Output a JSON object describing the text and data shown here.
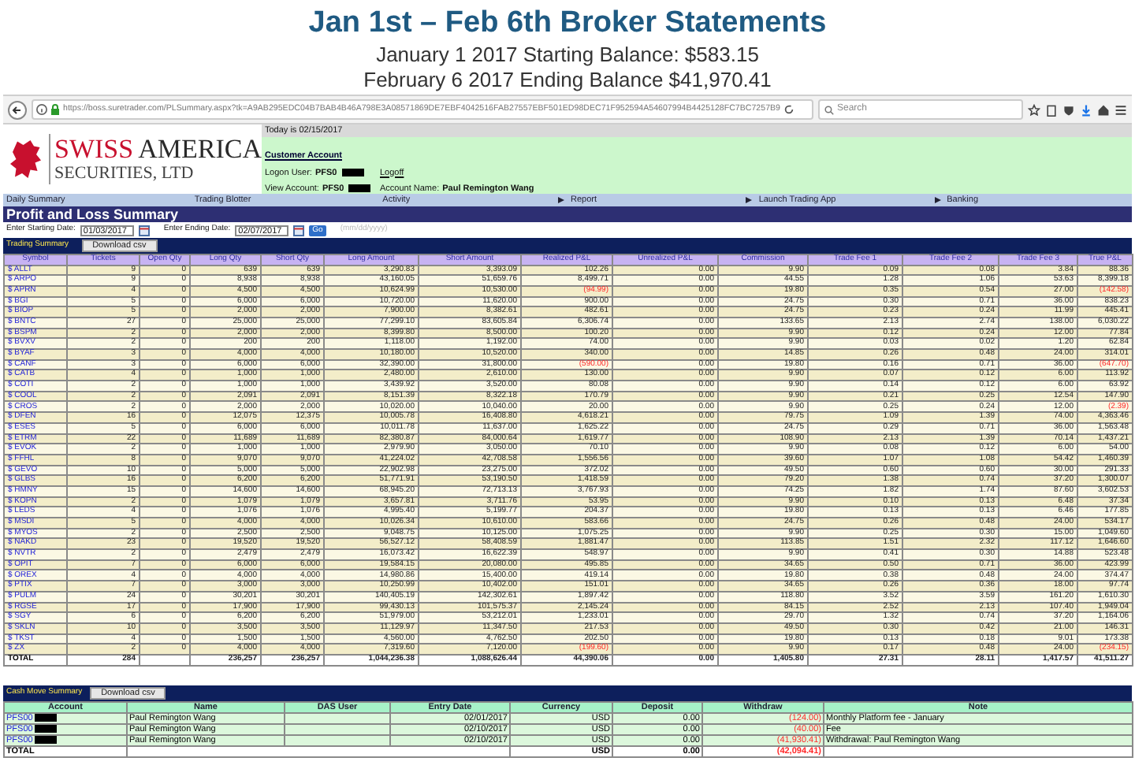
{
  "heading": {
    "title": "Jan 1st – Feb 6th Broker Statements",
    "lines": [
      "January 1 2017 Starting Balance: $583.15",
      "February 6 2017 Ending Balance $41,970.41"
    ]
  },
  "browser": {
    "url": "https://boss.suretrader.com/PLSummary.aspx?tk=A9AB295EDC04B7BAB4B46A798E3A08571869DE7EBF4042516FAB27557EBF501ED98DEC71F952594A54607994B4425128FC7BC7257B9",
    "search": {
      "placeholder": "Search"
    }
  },
  "site": {
    "logo_title_a": "SWISS",
    "logo_title_b": "AMERICA",
    "logo_subtitle": "SECURITIES, LTD",
    "today": "Today is 02/15/2017",
    "customer_account": "Customer Account",
    "logon_label": "Logon User:",
    "logon_value": "PFS0",
    "logoff": "Logoff",
    "view_label": "View Account:",
    "view_value": "PFS0",
    "account_name_label": "Account Name:",
    "account_name": "Paul Remington Wang"
  },
  "nav": [
    {
      "label": "Daily Summary",
      "has_submenu": false
    },
    {
      "label": "Trading Blotter",
      "has_submenu": false
    },
    {
      "label": "Activity",
      "has_submenu": true
    },
    {
      "label": "Report",
      "has_submenu": true
    },
    {
      "label": "Launch Trading App",
      "has_submenu": true
    },
    {
      "label": "Banking",
      "has_submenu": false
    }
  ],
  "page_title": "Profit and Loss Summary",
  "dates": {
    "start_label": "Enter Starting Date:",
    "start_value": "01/03/2017",
    "end_label": "Enter Ending Date:",
    "end_value": "02/07/2017",
    "go": "Go",
    "format_hint": "(mm/dd/yyyy)"
  },
  "trading": {
    "title": "Trading Summary",
    "download": "Download csv",
    "columns": [
      "Symbol",
      "Tickets",
      "Open Qty",
      "Long Qty",
      "Short Qty",
      "Long Amount",
      "Short Amount",
      "Realized P&L",
      "Unrealized P&L",
      "Commission",
      "Trade Fee 1",
      "Trade Fee 2",
      "Trade Fee 3",
      "True P&L"
    ],
    "rows": [
      {
        "cells": [
          "$ ALLT",
          "9",
          "0",
          "639",
          "639",
          "3,290.83",
          "3,393.09",
          "102.26",
          "0.00",
          "9.90",
          "0.09",
          "0.08",
          "3.84",
          "88.36"
        ]
      },
      {
        "cells": [
          "$ ARPO",
          "9",
          "0",
          "8,938",
          "8,938",
          "43,160.05",
          "51,659.76",
          "8,499.71",
          "0.00",
          "44.55",
          "1.28",
          "1.06",
          "53.63",
          "8,399.18"
        ]
      },
      {
        "cells": [
          "$ APRN",
          "4",
          "0",
          "4,500",
          "4,500",
          "10,624.99",
          "10,530.00",
          {
            "text": "(94.99)",
            "negative": true
          },
          "0.00",
          "19.80",
          "0.35",
          "0.54",
          "27.00",
          {
            "text": "(142.58)",
            "negative": true
          }
        ]
      },
      {
        "cells": [
          "$ BGI",
          "5",
          "0",
          "6,000",
          "6,000",
          "10,720.00",
          "11,620.00",
          "900.00",
          "0.00",
          "24.75",
          "0.30",
          "0.71",
          "36.00",
          "838.23"
        ]
      },
      {
        "cells": [
          "$ BIOP",
          "5",
          "0",
          "2,000",
          "2,000",
          "7,900.00",
          "8,382.61",
          "482.61",
          "0.00",
          "24.75",
          "0.23",
          "0.24",
          "11.99",
          "445.41"
        ]
      },
      {
        "cells": [
          "$ BNTC",
          "27",
          "0",
          "25,000",
          "25,000",
          "77,299.10",
          "83,605.84",
          "6,306.74",
          "0.00",
          "133.65",
          "2.13",
          "2.74",
          "138.00",
          "6,030.22"
        ]
      },
      {
        "cells": [
          "$ BSPM",
          "2",
          "0",
          "2,000",
          "2,000",
          "8,399.80",
          "8,500.00",
          "100.20",
          "0.00",
          "9.90",
          "0.12",
          "0.24",
          "12.00",
          "77.84"
        ]
      },
      {
        "cells": [
          "$ BVXV",
          "2",
          "0",
          "200",
          "200",
          "1,118.00",
          "1,192.00",
          "74.00",
          "0.00",
          "9.90",
          "0.03",
          "0.02",
          "1.20",
          "62.84"
        ]
      },
      {
        "cells": [
          "$ BYAF",
          "3",
          "0",
          "4,000",
          "4,000",
          "10,180.00",
          "10,520.00",
          "340.00",
          "0.00",
          "14.85",
          "0.26",
          "0.48",
          "24.00",
          "314.01"
        ]
      },
      {
        "cells": [
          "$ CANF",
          "3",
          "0",
          "6,000",
          "6,000",
          "32,390.00",
          "31,800.00",
          {
            "text": "(590.00)",
            "negative": true
          },
          "0.00",
          "19.80",
          "0.16",
          "0.71",
          "36.00",
          {
            "text": "(647.70)",
            "negative": true
          }
        ]
      },
      {
        "cells": [
          "$ CATB",
          "4",
          "0",
          "1,000",
          "1,000",
          "2,480.00",
          "2,610.00",
          "130.00",
          "0.00",
          "9.90",
          "0.07",
          "0.12",
          "6.00",
          "113.92"
        ]
      },
      {
        "cells": [
          "$ COTI",
          "2",
          "0",
          "1,000",
          "1,000",
          "3,439.92",
          "3,520.00",
          "80.08",
          "0.00",
          "9.90",
          "0.14",
          "0.12",
          "6.00",
          "63.92"
        ]
      },
      {
        "cells": [
          "$ COOL",
          "2",
          "0",
          "2,091",
          "2,091",
          "8,151.39",
          "8,322.18",
          "170.79",
          "0.00",
          "9.90",
          "0.21",
          "0.25",
          "12.54",
          "147.90"
        ]
      },
      {
        "cells": [
          "$ CROS",
          "2",
          "0",
          "2,000",
          "2,000",
          "10,020.00",
          "10,040.00",
          "20.00",
          "0.00",
          "9.90",
          "0.25",
          "0.24",
          "12.00",
          {
            "text": "(2.39)",
            "negative": true
          }
        ]
      },
      {
        "cells": [
          "$ DFEN",
          "16",
          "0",
          "12,075",
          "12,375",
          "10,005.78",
          "16,408.80",
          "4,618.21",
          "0.00",
          "79.75",
          "1.09",
          "1.39",
          "74.00",
          "4,363.46"
        ]
      },
      {
        "cells": [
          "$ ESES",
          "5",
          "0",
          "6,000",
          "6,000",
          "10,011.78",
          "11,637.00",
          "1,625.22",
          "0.00",
          "24.75",
          "0.29",
          "0.71",
          "36.00",
          "1,563.48"
        ]
      },
      {
        "cells": [
          "$ ETRM",
          "22",
          "0",
          "11,689",
          "11,689",
          "82,380.87",
          "84,000.64",
          "1,619.77",
          "0.00",
          "108.90",
          "2.13",
          "1.39",
          "70.14",
          "1,437.21"
        ]
      },
      {
        "cells": [
          "$ EVOK",
          "2",
          "0",
          "1,000",
          "1,000",
          "2,979.90",
          "3,050.00",
          "70.10",
          "0.00",
          "9.90",
          "0.08",
          "0.12",
          "6.00",
          "54.00"
        ]
      },
      {
        "cells": [
          "$ FFHL",
          "8",
          "0",
          "9,070",
          "9,070",
          "41,224.02",
          "42,708.58",
          "1,556.56",
          "0.00",
          "39.60",
          "1.07",
          "1.08",
          "54.42",
          "1,460.39"
        ]
      },
      {
        "cells": [
          "$ GEVO",
          "10",
          "0",
          "5,000",
          "5,000",
          "22,902.98",
          "23,275.00",
          "372.02",
          "0.00",
          "49.50",
          "0.60",
          "0.60",
          "30.00",
          "291.33"
        ]
      },
      {
        "cells": [
          "$ GLBS",
          "16",
          "0",
          "6,200",
          "6,200",
          "51,771.91",
          "53,190.50",
          "1,418.59",
          "0.00",
          "79.20",
          "1.38",
          "0.74",
          "37.20",
          "1,300.07"
        ]
      },
      {
        "cells": [
          "$ HMNY",
          "15",
          "0",
          "14,600",
          "14,600",
          "68,945.20",
          "72,713.13",
          "3,767.93",
          "0.00",
          "74.25",
          "1.82",
          "1.74",
          "87.60",
          "3,602.53"
        ]
      },
      {
        "cells": [
          "$ KOPN",
          "2",
          "0",
          "1,079",
          "1,079",
          "3,657.81",
          "3,711.76",
          "53.95",
          "0.00",
          "9.90",
          "0.10",
          "0.13",
          "6.48",
          "37.34"
        ]
      },
      {
        "cells": [
          "$ LEDS",
          "4",
          "0",
          "1,076",
          "1,076",
          "4,995.40",
          "5,199.77",
          "204.37",
          "0.00",
          "19.80",
          "0.13",
          "0.13",
          "6.46",
          "177.85"
        ]
      },
      {
        "cells": [
          "$ MSDI",
          "5",
          "0",
          "4,000",
          "4,000",
          "10,026.34",
          "10,610.00",
          "583.66",
          "0.00",
          "24.75",
          "0.26",
          "0.48",
          "24.00",
          "534.17"
        ]
      },
      {
        "cells": [
          "$ MYOS",
          "2",
          "0",
          "2,500",
          "2,500",
          "9,048.75",
          "10,125.00",
          "1,075.25",
          "0.00",
          "9.90",
          "0.25",
          "0.30",
          "15.00",
          "1,049.60"
        ]
      },
      {
        "cells": [
          "$ NAKD",
          "23",
          "0",
          "19,520",
          "19,520",
          "56,527.12",
          "58,408.59",
          "1,881.47",
          "0.00",
          "113.85",
          "1.51",
          "2.32",
          "117.12",
          "1,646.60"
        ]
      },
      {
        "cells": [
          "$ NVTR",
          "2",
          "0",
          "2,479",
          "2,479",
          "16,073.42",
          "16,622.39",
          "548.97",
          "0.00",
          "9.90",
          "0.41",
          "0.30",
          "14.88",
          "523.48"
        ]
      },
      {
        "cells": [
          "$ OPIT",
          "7",
          "0",
          "6,000",
          "6,000",
          "19,584.15",
          "20,080.00",
          "495.85",
          "0.00",
          "34.65",
          "0.50",
          "0.71",
          "36.00",
          "423.99"
        ]
      },
      {
        "cells": [
          "$ OREX",
          "4",
          "0",
          "4,000",
          "4,000",
          "14,980.86",
          "15,400.00",
          "419.14",
          "0.00",
          "19.80",
          "0.38",
          "0.48",
          "24.00",
          "374.47"
        ]
      },
      {
        "cells": [
          "$ PTIX",
          "7",
          "0",
          "3,000",
          "3,000",
          "10,250.99",
          "10,402.00",
          "151.01",
          "0.00",
          "34.65",
          "0.26",
          "0.36",
          "18.00",
          "97.74"
        ]
      },
      {
        "cells": [
          "$ PULM",
          "24",
          "0",
          "30,201",
          "30,201",
          "140,405.19",
          "142,302.61",
          "1,897.42",
          "0.00",
          "118.80",
          "3.52",
          "3.59",
          "161.20",
          "1,610.30"
        ]
      },
      {
        "cells": [
          "$ RGSE",
          "17",
          "0",
          "17,900",
          "17,900",
          "99,430.13",
          "101,575.37",
          "2,145.24",
          "0.00",
          "84.15",
          "2.52",
          "2.13",
          "107.40",
          "1,949.04"
        ]
      },
      {
        "cells": [
          "$ SGY",
          "6",
          "0",
          "6,200",
          "6,200",
          "51,979.00",
          "53,212.01",
          "1,233.01",
          "0.00",
          "29.70",
          "1.32",
          "0.74",
          "37.20",
          "1,164.06"
        ]
      },
      {
        "cells": [
          "$ SKLN",
          "10",
          "0",
          "3,500",
          "3,500",
          "11,129.97",
          "11,347.50",
          "217.53",
          "0.00",
          "49.50",
          "0.30",
          "0.42",
          "21.00",
          "146.31"
        ]
      },
      {
        "cells": [
          "$ TKST",
          "4",
          "0",
          "1,500",
          "1,500",
          "4,560.00",
          "4,762.50",
          "202.50",
          "0.00",
          "19.80",
          "0.13",
          "0.18",
          "9.01",
          "173.38"
        ]
      },
      {
        "cells": [
          "$ ZX",
          "2",
          "0",
          "4,000",
          "4,000",
          "7,319.60",
          "7,120.00",
          {
            "text": "(199.60)",
            "negative": true
          },
          "0.00",
          "9.90",
          "0.17",
          "0.48",
          "24.00",
          {
            "text": "(234.15)",
            "negative": true
          }
        ]
      }
    ],
    "total": {
      "cells": [
        "TOTAL",
        "284",
        "",
        "236,257",
        "236,257",
        "1,044,236.38",
        "1,088,626.44",
        "44,390.06",
        "0.00",
        "1,405.80",
        "27.31",
        "28.11",
        "1,417.57",
        "41,511.27"
      ]
    }
  },
  "cash": {
    "title": "Cash Move Summary",
    "download": "Download csv",
    "columns": [
      "Account",
      "Name",
      "DAS User",
      "Entry Date",
      "Currency",
      "Deposit",
      "Withdraw",
      "Note"
    ],
    "rows": [
      {
        "account": "PFS00",
        "name": "Paul Remington Wang",
        "das_user": "",
        "entry_date": "02/01/2017",
        "currency": "USD",
        "deposit": "0.00",
        "withdraw": "(124.00)",
        "note": "Monthly Platform fee - January"
      },
      {
        "account": "PFS00",
        "name": "Paul Remington Wang",
        "das_user": "",
        "entry_date": "02/10/2017",
        "currency": "USD",
        "deposit": "0.00",
        "withdraw": "(40.00)",
        "note": "Fee"
      },
      {
        "account": "PFS00",
        "name": "Paul Remington Wang",
        "das_user": "",
        "entry_date": "02/10/2017",
        "currency": "USD",
        "deposit": "0.00",
        "withdraw": "(41,930.41)",
        "note": "Withdrawal: Paul Remington Wang"
      }
    ],
    "total": {
      "label": "TOTAL",
      "currency": "USD",
      "deposit": "0.00",
      "withdraw": "(42,094.41)"
    }
  }
}
